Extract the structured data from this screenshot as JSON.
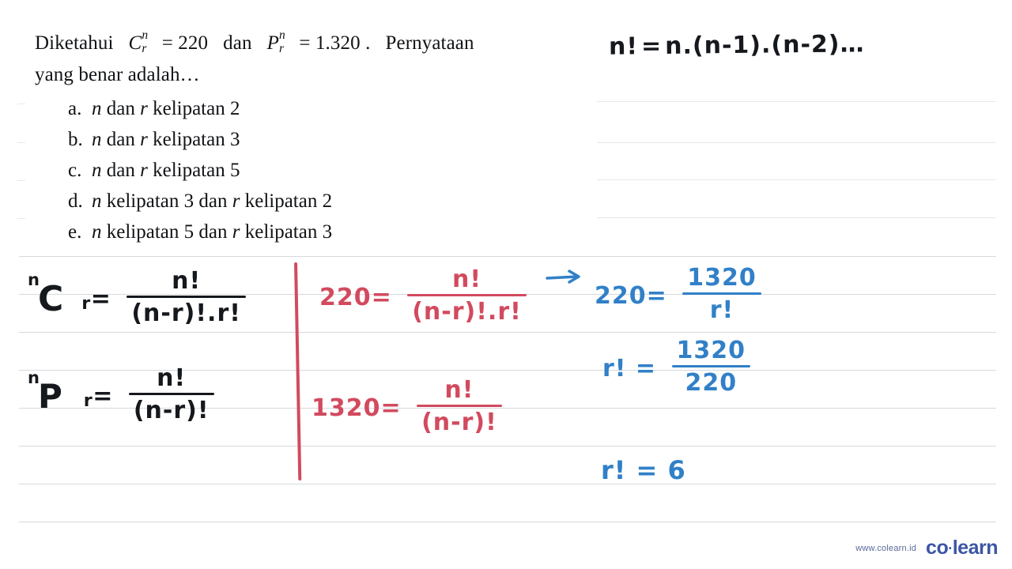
{
  "document": {
    "type": "math-worksheet",
    "subject": "combinatorics",
    "background_color": "#ffffff",
    "rule_line_color": "#d6d9dd"
  },
  "question": {
    "line1_prefix": "Diketahui",
    "combination_symbol": {
      "base": "C",
      "sup": "n",
      "sub": "r"
    },
    "combination_equals": "= 220",
    "conjunction": "dan",
    "permutation_symbol": {
      "base": "P",
      "sup": "n",
      "sub": "r"
    },
    "permutation_equals": "= 1.320",
    "period": ".",
    "line1_suffix": "Pernyataan",
    "line2": "yang benar adalah…"
  },
  "options": [
    {
      "label": "a.",
      "text_parts": [
        "n",
        " dan ",
        "r",
        " kelipatan 2"
      ],
      "full": "n dan r kelipatan 2"
    },
    {
      "label": "b.",
      "text_parts": [
        "n",
        " dan ",
        "r",
        " kelipatan 3"
      ],
      "full": "n dan r kelipatan 3"
    },
    {
      "label": "c.",
      "text_parts": [
        "n",
        " dan ",
        "r",
        " kelipatan 5"
      ],
      "full": "n dan r kelipatan 5"
    },
    {
      "label": "d.",
      "text_parts": [
        "n",
        " kelipatan 3 dan ",
        "r",
        " kelipatan 2"
      ],
      "full": "n kelipatan 3 dan r kelipatan 2"
    },
    {
      "label": "e.",
      "text_parts": [
        "n",
        " kelipatan 5 dan ",
        "r",
        " kelipatan 3"
      ],
      "full": "n kelipatan 5 dan r kelipatan 3"
    }
  ],
  "handwriting": {
    "ink_colors": {
      "black": "#15181c",
      "red": "#d24a5e",
      "blue": "#3180c8"
    },
    "factorial_note": {
      "color": "black",
      "text": "n! = n.(n-1).(n-2)…",
      "lhs": "n!",
      "eq": "=",
      "rhs": "n.(n-1).(n-2)…"
    },
    "formula_combination": {
      "color": "black",
      "symbol_sup": "n",
      "symbol_base": "C",
      "symbol_sub": "r",
      "eq": "=",
      "numerator": "n!",
      "denominator": "(n-r)!.r!"
    },
    "formula_permutation": {
      "color": "black",
      "symbol_sup": "n",
      "symbol_base": "P",
      "symbol_sub": "r",
      "eq": "=",
      "numerator": "n!",
      "denominator": "(n-r)!"
    },
    "equation_combination": {
      "color": "red",
      "lhs": "220=",
      "numerator": "n!",
      "denominator": "(n-r)!.r!"
    },
    "equation_permutation": {
      "color": "red",
      "lhs": "1320=",
      "numerator": "n!",
      "denominator": "(n-r)!"
    },
    "step_substitute": {
      "color": "blue",
      "arrow": "→",
      "lhs": "220=",
      "numerator": "1320",
      "denominator": "r!"
    },
    "step_solve_rfact": {
      "color": "blue",
      "lhs": "r! =",
      "numerator": "1320",
      "denominator": "220"
    },
    "step_result": {
      "color": "blue",
      "text": "r! = 6"
    }
  },
  "watermark": {
    "url": "www.colearn.id",
    "brand_left": "co",
    "brand_dot": "·",
    "brand_right": "learn",
    "brand_color": "#3c55a5"
  }
}
